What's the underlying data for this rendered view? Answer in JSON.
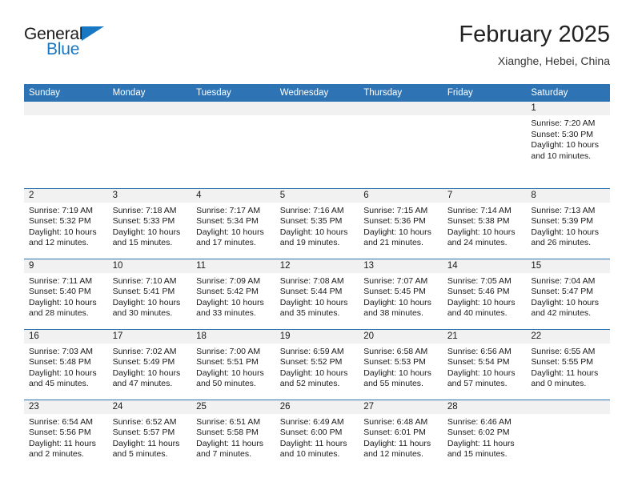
{
  "brand": {
    "name_part1": "General",
    "name_part2": "Blue",
    "accent_color": "#1878c4"
  },
  "header": {
    "title": "February 2025",
    "location": "Xianghe, Hebei, China"
  },
  "theme": {
    "header_blue": "#2e74b5",
    "daynum_band": "#f1f1f1"
  },
  "weekdays": [
    "Sunday",
    "Monday",
    "Tuesday",
    "Wednesday",
    "Thursday",
    "Friday",
    "Saturday"
  ],
  "weeks": [
    [
      {
        "day": "",
        "sunrise": "",
        "sunset": "",
        "daylight": ""
      },
      {
        "day": "",
        "sunrise": "",
        "sunset": "",
        "daylight": ""
      },
      {
        "day": "",
        "sunrise": "",
        "sunset": "",
        "daylight": ""
      },
      {
        "day": "",
        "sunrise": "",
        "sunset": "",
        "daylight": ""
      },
      {
        "day": "",
        "sunrise": "",
        "sunset": "",
        "daylight": ""
      },
      {
        "day": "",
        "sunrise": "",
        "sunset": "",
        "daylight": ""
      },
      {
        "day": "1",
        "sunrise": "Sunrise: 7:20 AM",
        "sunset": "Sunset: 5:30 PM",
        "daylight": "Daylight: 10 hours and 10 minutes."
      }
    ],
    [
      {
        "day": "2",
        "sunrise": "Sunrise: 7:19 AM",
        "sunset": "Sunset: 5:32 PM",
        "daylight": "Daylight: 10 hours and 12 minutes."
      },
      {
        "day": "3",
        "sunrise": "Sunrise: 7:18 AM",
        "sunset": "Sunset: 5:33 PM",
        "daylight": "Daylight: 10 hours and 15 minutes."
      },
      {
        "day": "4",
        "sunrise": "Sunrise: 7:17 AM",
        "sunset": "Sunset: 5:34 PM",
        "daylight": "Daylight: 10 hours and 17 minutes."
      },
      {
        "day": "5",
        "sunrise": "Sunrise: 7:16 AM",
        "sunset": "Sunset: 5:35 PM",
        "daylight": "Daylight: 10 hours and 19 minutes."
      },
      {
        "day": "6",
        "sunrise": "Sunrise: 7:15 AM",
        "sunset": "Sunset: 5:36 PM",
        "daylight": "Daylight: 10 hours and 21 minutes."
      },
      {
        "day": "7",
        "sunrise": "Sunrise: 7:14 AM",
        "sunset": "Sunset: 5:38 PM",
        "daylight": "Daylight: 10 hours and 24 minutes."
      },
      {
        "day": "8",
        "sunrise": "Sunrise: 7:13 AM",
        "sunset": "Sunset: 5:39 PM",
        "daylight": "Daylight: 10 hours and 26 minutes."
      }
    ],
    [
      {
        "day": "9",
        "sunrise": "Sunrise: 7:11 AM",
        "sunset": "Sunset: 5:40 PM",
        "daylight": "Daylight: 10 hours and 28 minutes."
      },
      {
        "day": "10",
        "sunrise": "Sunrise: 7:10 AM",
        "sunset": "Sunset: 5:41 PM",
        "daylight": "Daylight: 10 hours and 30 minutes."
      },
      {
        "day": "11",
        "sunrise": "Sunrise: 7:09 AM",
        "sunset": "Sunset: 5:42 PM",
        "daylight": "Daylight: 10 hours and 33 minutes."
      },
      {
        "day": "12",
        "sunrise": "Sunrise: 7:08 AM",
        "sunset": "Sunset: 5:44 PM",
        "daylight": "Daylight: 10 hours and 35 minutes."
      },
      {
        "day": "13",
        "sunrise": "Sunrise: 7:07 AM",
        "sunset": "Sunset: 5:45 PM",
        "daylight": "Daylight: 10 hours and 38 minutes."
      },
      {
        "day": "14",
        "sunrise": "Sunrise: 7:05 AM",
        "sunset": "Sunset: 5:46 PM",
        "daylight": "Daylight: 10 hours and 40 minutes."
      },
      {
        "day": "15",
        "sunrise": "Sunrise: 7:04 AM",
        "sunset": "Sunset: 5:47 PM",
        "daylight": "Daylight: 10 hours and 42 minutes."
      }
    ],
    [
      {
        "day": "16",
        "sunrise": "Sunrise: 7:03 AM",
        "sunset": "Sunset: 5:48 PM",
        "daylight": "Daylight: 10 hours and 45 minutes."
      },
      {
        "day": "17",
        "sunrise": "Sunrise: 7:02 AM",
        "sunset": "Sunset: 5:49 PM",
        "daylight": "Daylight: 10 hours and 47 minutes."
      },
      {
        "day": "18",
        "sunrise": "Sunrise: 7:00 AM",
        "sunset": "Sunset: 5:51 PM",
        "daylight": "Daylight: 10 hours and 50 minutes."
      },
      {
        "day": "19",
        "sunrise": "Sunrise: 6:59 AM",
        "sunset": "Sunset: 5:52 PM",
        "daylight": "Daylight: 10 hours and 52 minutes."
      },
      {
        "day": "20",
        "sunrise": "Sunrise: 6:58 AM",
        "sunset": "Sunset: 5:53 PM",
        "daylight": "Daylight: 10 hours and 55 minutes."
      },
      {
        "day": "21",
        "sunrise": "Sunrise: 6:56 AM",
        "sunset": "Sunset: 5:54 PM",
        "daylight": "Daylight: 10 hours and 57 minutes."
      },
      {
        "day": "22",
        "sunrise": "Sunrise: 6:55 AM",
        "sunset": "Sunset: 5:55 PM",
        "daylight": "Daylight: 11 hours and 0 minutes."
      }
    ],
    [
      {
        "day": "23",
        "sunrise": "Sunrise: 6:54 AM",
        "sunset": "Sunset: 5:56 PM",
        "daylight": "Daylight: 11 hours and 2 minutes."
      },
      {
        "day": "24",
        "sunrise": "Sunrise: 6:52 AM",
        "sunset": "Sunset: 5:57 PM",
        "daylight": "Daylight: 11 hours and 5 minutes."
      },
      {
        "day": "25",
        "sunrise": "Sunrise: 6:51 AM",
        "sunset": "Sunset: 5:58 PM",
        "daylight": "Daylight: 11 hours and 7 minutes."
      },
      {
        "day": "26",
        "sunrise": "Sunrise: 6:49 AM",
        "sunset": "Sunset: 6:00 PM",
        "daylight": "Daylight: 11 hours and 10 minutes."
      },
      {
        "day": "27",
        "sunrise": "Sunrise: 6:48 AM",
        "sunset": "Sunset: 6:01 PM",
        "daylight": "Daylight: 11 hours and 12 minutes."
      },
      {
        "day": "28",
        "sunrise": "Sunrise: 6:46 AM",
        "sunset": "Sunset: 6:02 PM",
        "daylight": "Daylight: 11 hours and 15 minutes."
      },
      {
        "day": "",
        "sunrise": "",
        "sunset": "",
        "daylight": ""
      }
    ]
  ]
}
